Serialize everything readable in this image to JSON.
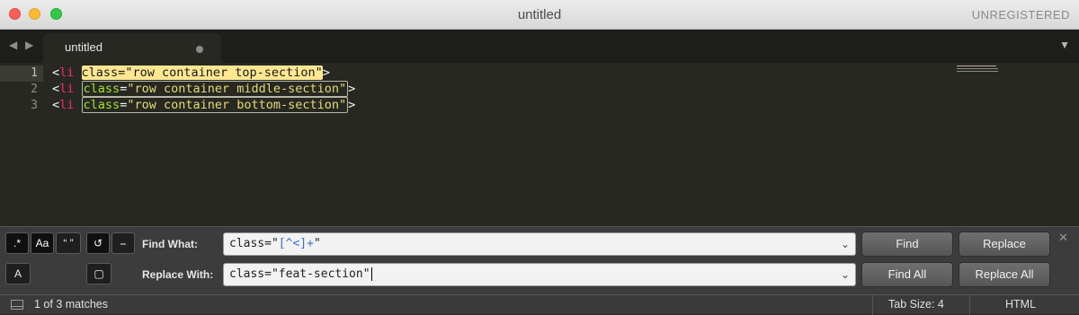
{
  "window": {
    "title": "untitled",
    "registration": "UNREGISTERED"
  },
  "tabbar": {
    "tab_label": "untitled",
    "back_icon": "left-arrow-icon",
    "forward_icon": "right-arrow-icon",
    "dirty_icon": "unsaved-dot-icon",
    "overflow_icon": "tab-dropdown-icon"
  },
  "editor": {
    "active_line": 1,
    "lines": [
      {
        "number": "1",
        "tag_open": "<",
        "tag": "li",
        "space": " ",
        "match": "class=\"row container top-section\"",
        "tag_close": ">"
      },
      {
        "number": "2",
        "tag_open": "<",
        "tag": "li",
        "space": " ",
        "attr": "class",
        "eq": "=",
        "value": "\"row container middle-section\"",
        "tag_close": ">"
      },
      {
        "number": "3",
        "tag_open": "<",
        "tag": "li",
        "space": " ",
        "attr": "class",
        "eq": "=",
        "value": "\"row container bottom-section\"",
        "tag_close": ">"
      }
    ]
  },
  "find_panel": {
    "options": [
      {
        "label": ".*",
        "name": "regex-toggle",
        "active": true
      },
      {
        "label": "Aa",
        "name": "case-sensitive-toggle",
        "active": true
      },
      {
        "label": "“ ”",
        "name": "whole-word-toggle",
        "active": false
      },
      {
        "label": "↺",
        "name": "wrap-toggle",
        "active": true
      },
      {
        "label": "⎯",
        "name": "in-selection-toggle",
        "active": false
      },
      {
        "label": "A",
        "name": "preserve-case-toggle",
        "active": false
      },
      {
        "label": "▢",
        "name": "highlight-matches-toggle",
        "active": false
      }
    ],
    "find_label": "Find What:",
    "find_value_prefix": "class=\"",
    "find_value_regex": "[^<]+",
    "find_value_suffix": "\"",
    "replace_label": "Replace With:",
    "replace_value": "class=\"feat-section\"",
    "buttons": {
      "find": "Find",
      "replace": "Replace",
      "find_all": "Find All",
      "replace_all": "Replace All"
    },
    "close_glyph": "✕"
  },
  "statusbar": {
    "matches": "1 of 3 matches",
    "tab_size": "Tab Size: 4",
    "syntax": "HTML"
  },
  "colors": {
    "editor_bg": "#272822",
    "current_match": "#ffe792",
    "tag": "#f92672",
    "attribute": "#a6e22e",
    "string": "#e6db74"
  }
}
